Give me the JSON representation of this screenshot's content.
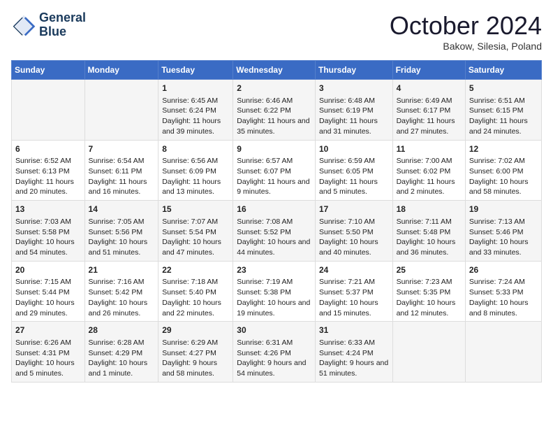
{
  "header": {
    "logo_line1": "General",
    "logo_line2": "Blue",
    "month": "October 2024",
    "location": "Bakow, Silesia, Poland"
  },
  "weekdays": [
    "Sunday",
    "Monday",
    "Tuesday",
    "Wednesday",
    "Thursday",
    "Friday",
    "Saturday"
  ],
  "weeks": [
    [
      {
        "day": "",
        "sunrise": "",
        "sunset": "",
        "daylight": ""
      },
      {
        "day": "",
        "sunrise": "",
        "sunset": "",
        "daylight": ""
      },
      {
        "day": "1",
        "sunrise": "Sunrise: 6:45 AM",
        "sunset": "Sunset: 6:24 PM",
        "daylight": "Daylight: 11 hours and 39 minutes."
      },
      {
        "day": "2",
        "sunrise": "Sunrise: 6:46 AM",
        "sunset": "Sunset: 6:22 PM",
        "daylight": "Daylight: 11 hours and 35 minutes."
      },
      {
        "day": "3",
        "sunrise": "Sunrise: 6:48 AM",
        "sunset": "Sunset: 6:19 PM",
        "daylight": "Daylight: 11 hours and 31 minutes."
      },
      {
        "day": "4",
        "sunrise": "Sunrise: 6:49 AM",
        "sunset": "Sunset: 6:17 PM",
        "daylight": "Daylight: 11 hours and 27 minutes."
      },
      {
        "day": "5",
        "sunrise": "Sunrise: 6:51 AM",
        "sunset": "Sunset: 6:15 PM",
        "daylight": "Daylight: 11 hours and 24 minutes."
      }
    ],
    [
      {
        "day": "6",
        "sunrise": "Sunrise: 6:52 AM",
        "sunset": "Sunset: 6:13 PM",
        "daylight": "Daylight: 11 hours and 20 minutes."
      },
      {
        "day": "7",
        "sunrise": "Sunrise: 6:54 AM",
        "sunset": "Sunset: 6:11 PM",
        "daylight": "Daylight: 11 hours and 16 minutes."
      },
      {
        "day": "8",
        "sunrise": "Sunrise: 6:56 AM",
        "sunset": "Sunset: 6:09 PM",
        "daylight": "Daylight: 11 hours and 13 minutes."
      },
      {
        "day": "9",
        "sunrise": "Sunrise: 6:57 AM",
        "sunset": "Sunset: 6:07 PM",
        "daylight": "Daylight: 11 hours and 9 minutes."
      },
      {
        "day": "10",
        "sunrise": "Sunrise: 6:59 AM",
        "sunset": "Sunset: 6:05 PM",
        "daylight": "Daylight: 11 hours and 5 minutes."
      },
      {
        "day": "11",
        "sunrise": "Sunrise: 7:00 AM",
        "sunset": "Sunset: 6:02 PM",
        "daylight": "Daylight: 11 hours and 2 minutes."
      },
      {
        "day": "12",
        "sunrise": "Sunrise: 7:02 AM",
        "sunset": "Sunset: 6:00 PM",
        "daylight": "Daylight: 10 hours and 58 minutes."
      }
    ],
    [
      {
        "day": "13",
        "sunrise": "Sunrise: 7:03 AM",
        "sunset": "Sunset: 5:58 PM",
        "daylight": "Daylight: 10 hours and 54 minutes."
      },
      {
        "day": "14",
        "sunrise": "Sunrise: 7:05 AM",
        "sunset": "Sunset: 5:56 PM",
        "daylight": "Daylight: 10 hours and 51 minutes."
      },
      {
        "day": "15",
        "sunrise": "Sunrise: 7:07 AM",
        "sunset": "Sunset: 5:54 PM",
        "daylight": "Daylight: 10 hours and 47 minutes."
      },
      {
        "day": "16",
        "sunrise": "Sunrise: 7:08 AM",
        "sunset": "Sunset: 5:52 PM",
        "daylight": "Daylight: 10 hours and 44 minutes."
      },
      {
        "day": "17",
        "sunrise": "Sunrise: 7:10 AM",
        "sunset": "Sunset: 5:50 PM",
        "daylight": "Daylight: 10 hours and 40 minutes."
      },
      {
        "day": "18",
        "sunrise": "Sunrise: 7:11 AM",
        "sunset": "Sunset: 5:48 PM",
        "daylight": "Daylight: 10 hours and 36 minutes."
      },
      {
        "day": "19",
        "sunrise": "Sunrise: 7:13 AM",
        "sunset": "Sunset: 5:46 PM",
        "daylight": "Daylight: 10 hours and 33 minutes."
      }
    ],
    [
      {
        "day": "20",
        "sunrise": "Sunrise: 7:15 AM",
        "sunset": "Sunset: 5:44 PM",
        "daylight": "Daylight: 10 hours and 29 minutes."
      },
      {
        "day": "21",
        "sunrise": "Sunrise: 7:16 AM",
        "sunset": "Sunset: 5:42 PM",
        "daylight": "Daylight: 10 hours and 26 minutes."
      },
      {
        "day": "22",
        "sunrise": "Sunrise: 7:18 AM",
        "sunset": "Sunset: 5:40 PM",
        "daylight": "Daylight: 10 hours and 22 minutes."
      },
      {
        "day": "23",
        "sunrise": "Sunrise: 7:19 AM",
        "sunset": "Sunset: 5:38 PM",
        "daylight": "Daylight: 10 hours and 19 minutes."
      },
      {
        "day": "24",
        "sunrise": "Sunrise: 7:21 AM",
        "sunset": "Sunset: 5:37 PM",
        "daylight": "Daylight: 10 hours and 15 minutes."
      },
      {
        "day": "25",
        "sunrise": "Sunrise: 7:23 AM",
        "sunset": "Sunset: 5:35 PM",
        "daylight": "Daylight: 10 hours and 12 minutes."
      },
      {
        "day": "26",
        "sunrise": "Sunrise: 7:24 AM",
        "sunset": "Sunset: 5:33 PM",
        "daylight": "Daylight: 10 hours and 8 minutes."
      }
    ],
    [
      {
        "day": "27",
        "sunrise": "Sunrise: 6:26 AM",
        "sunset": "Sunset: 4:31 PM",
        "daylight": "Daylight: 10 hours and 5 minutes."
      },
      {
        "day": "28",
        "sunrise": "Sunrise: 6:28 AM",
        "sunset": "Sunset: 4:29 PM",
        "daylight": "Daylight: 10 hours and 1 minute."
      },
      {
        "day": "29",
        "sunrise": "Sunrise: 6:29 AM",
        "sunset": "Sunset: 4:27 PM",
        "daylight": "Daylight: 9 hours and 58 minutes."
      },
      {
        "day": "30",
        "sunrise": "Sunrise: 6:31 AM",
        "sunset": "Sunset: 4:26 PM",
        "daylight": "Daylight: 9 hours and 54 minutes."
      },
      {
        "day": "31",
        "sunrise": "Sunrise: 6:33 AM",
        "sunset": "Sunset: 4:24 PM",
        "daylight": "Daylight: 9 hours and 51 minutes."
      },
      {
        "day": "",
        "sunrise": "",
        "sunset": "",
        "daylight": ""
      },
      {
        "day": "",
        "sunrise": "",
        "sunset": "",
        "daylight": ""
      }
    ]
  ]
}
